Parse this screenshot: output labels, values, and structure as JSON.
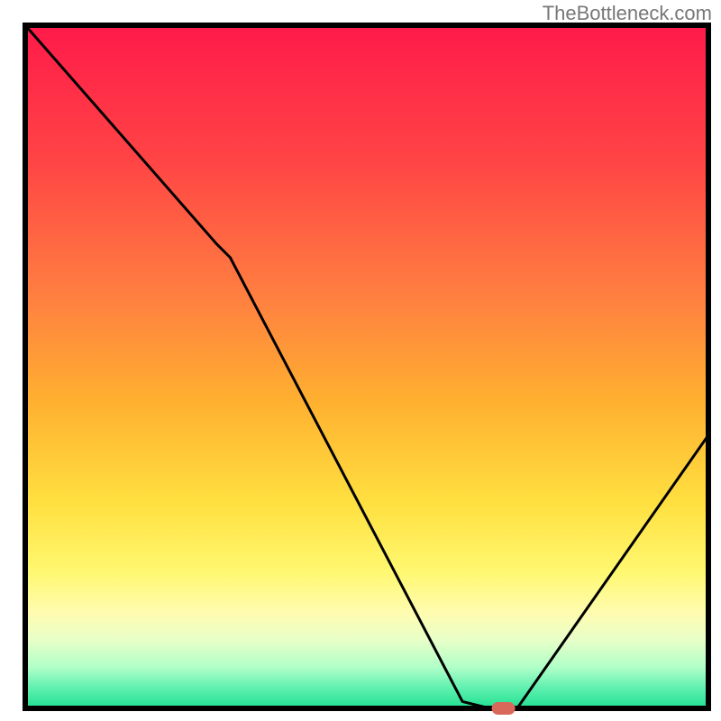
{
  "attribution": "TheBottleneck.com",
  "chart_data": {
    "type": "line",
    "title": "",
    "xlabel": "",
    "ylabel": "",
    "xlim": [
      0,
      100
    ],
    "ylim": [
      0,
      100
    ],
    "x": [
      0,
      28,
      30,
      64,
      68,
      72,
      100
    ],
    "y": [
      100,
      68,
      66,
      1,
      0,
      0,
      40
    ],
    "marker": {
      "x": 70,
      "y": 0,
      "color": "#d9685a"
    },
    "gradient_stops": [
      {
        "offset": 0.0,
        "color": "#ff1a4a"
      },
      {
        "offset": 0.2,
        "color": "#ff4545"
      },
      {
        "offset": 0.4,
        "color": "#ff8040"
      },
      {
        "offset": 0.55,
        "color": "#ffb030"
      },
      {
        "offset": 0.7,
        "color": "#ffe040"
      },
      {
        "offset": 0.8,
        "color": "#fff870"
      },
      {
        "offset": 0.86,
        "color": "#fffcb0"
      },
      {
        "offset": 0.9,
        "color": "#e8ffc8"
      },
      {
        "offset": 0.94,
        "color": "#b0ffc8"
      },
      {
        "offset": 0.97,
        "color": "#60f0b0"
      },
      {
        "offset": 1.0,
        "color": "#20e090"
      }
    ],
    "border_color": "#000000",
    "line_color": "#000000",
    "line_width": 3
  }
}
